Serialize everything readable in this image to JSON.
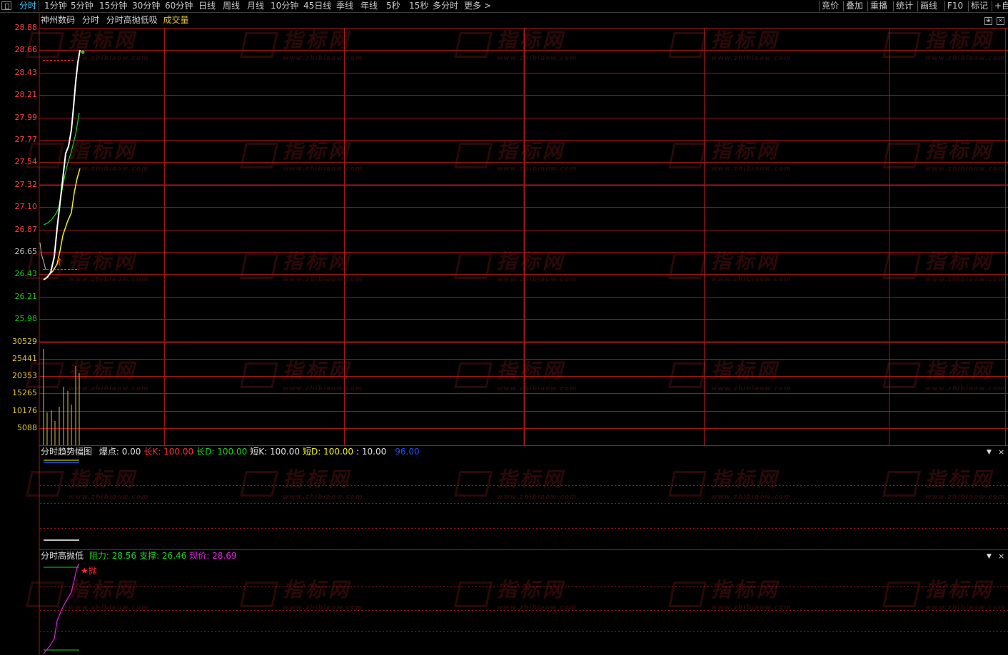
{
  "toolbar": {
    "tabs": [
      "分时",
      "1分钟",
      "5分钟",
      "15分钟",
      "30分钟",
      "60分钟",
      "日线",
      "周线",
      "月线",
      "10分钟",
      "45日线",
      "季线",
      "年线",
      "5秒",
      "15秒",
      "多分时",
      "更多 >"
    ],
    "right_buttons": [
      "竞价",
      "叠加",
      "重播",
      "统计",
      "画线",
      "F10",
      "标记",
      "+自"
    ]
  },
  "main_title": {
    "stock_name": "神州数码",
    "mode": "分时",
    "indicator": "分时高抛低吸",
    "volume_label": "成交量"
  },
  "price_axis": [
    "28.88",
    "28.66",
    "28.43",
    "28.21",
    "27.99",
    "27.77",
    "27.54",
    "27.32",
    "27.10",
    "26.87",
    "26.65",
    "26.43",
    "26.21",
    "25.98"
  ],
  "volume_axis": [
    "30529",
    "25441",
    "20353",
    "15265",
    "10176",
    "5088"
  ],
  "colors": {
    "grid": "#a01818",
    "price_up": "#ff4040",
    "price_down": "#20c020",
    "neutral": "#c0c0c0",
    "volume_axis": "#e0c040",
    "white_line": "#ffffff",
    "green_line": "#20d020",
    "yellow_line": "#f0f020",
    "magenta": "#e020e0",
    "blue": "#2050ff"
  },
  "chart_data": {
    "type": "line",
    "ylim": [
      25.98,
      28.88
    ],
    "series": [],
    "volume_ylim": [
      0,
      30529
    ]
  },
  "indicator1": {
    "name": "分时趋势幅图",
    "items": [
      {
        "label": "爆点:",
        "value": "0.00",
        "color": "#e0e0e0"
      },
      {
        "label": "长K:",
        "value": "100.00",
        "color": "#ff3030"
      },
      {
        "label": "长D:",
        "value": "100.00",
        "color": "#20d020"
      },
      {
        "label": "短K:",
        "value": "100.00",
        "color": "#e0e0e0"
      },
      {
        "label": "短D:",
        "value": "100.00",
        "color": "#f0f020"
      },
      {
        "label": ":",
        "value": "10.00",
        "color": "#e0e0e0"
      },
      {
        "label": "",
        "value": "96.00",
        "color": "#2050ff"
      }
    ]
  },
  "indicator2": {
    "name": "分时高抛低",
    "items": [
      {
        "label": "阻力:",
        "value": "28.56",
        "color": "#20d020"
      },
      {
        "label": "支撑:",
        "value": "26.46",
        "color": "#20d020"
      },
      {
        "label": "现价:",
        "value": "28.69",
        "color": "#e020e0"
      }
    ],
    "signal_text": "★抛"
  },
  "watermark": {
    "main": "指标网",
    "sub": "www.zhibiaow.com"
  }
}
